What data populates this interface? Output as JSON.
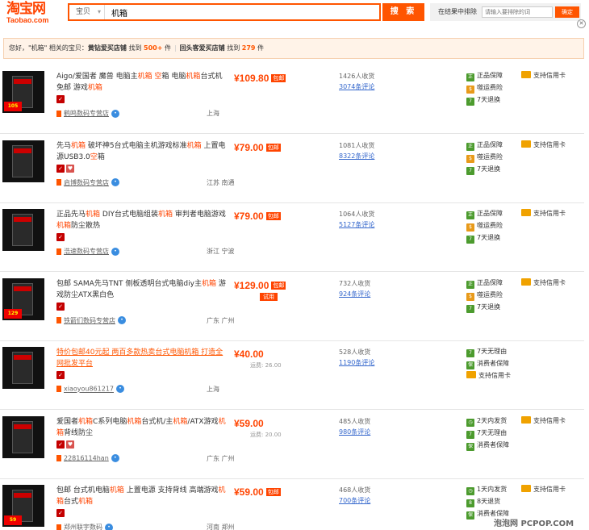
{
  "header": {
    "logo_main": "淘宝网",
    "logo_sub": "Taobao.com",
    "search_scope": "宝贝",
    "search_query": "机箱",
    "search_button": "搜 索",
    "within_label": "在结果中排除",
    "within_placeholder": "请输入要排除的词",
    "within_button": "确定"
  },
  "notice": {
    "prefix": "您好，\"机箱\" 相关的宝贝：",
    "tier1_label": "黄钻爱买店铺",
    "tier1_mid": " 找到 ",
    "tier1_count": "500+",
    "tier1_unit": " 件",
    "tier2_label": "回头客爱买店铺",
    "tier2_mid": " 找到 ",
    "tier2_count": "279",
    "tier2_unit": " 件"
  },
  "products": [
    {
      "title_parts": [
        "Aigo/爱国者 魔兽 电脑主",
        "机箱",
        " ",
        "空",
        "箱 电脑",
        "机箱",
        "台式机免邮 游戏",
        "机箱"
      ],
      "price": "¥109.80",
      "tag": "包邮",
      "trial": "",
      "freight": "",
      "sales": "1426人收货",
      "reviews": "3074条评论",
      "shop": "鹤鸣数码专营店",
      "location": "上海",
      "services": [
        "正品保障",
        "支持信用卡",
        "噬运费险",
        "7天退换"
      ],
      "thumb_badge": "105"
    },
    {
      "title_parts": [
        "先马",
        "机箱",
        " 破坏神5台式电脑主机游戏标准",
        "机箱",
        " 上置电源USB3.0",
        "空",
        "箱"
      ],
      "price": "¥79.00",
      "tag": "包邮",
      "trial": "",
      "freight": "",
      "sales": "1081人收货",
      "reviews": "8322条评论",
      "shop": "启博数码专营店",
      "location": "江苏 南通",
      "services": [
        "正品保障",
        "支持信用卡",
        "噬运费险",
        "7天退换"
      ],
      "thumb_badge": ""
    },
    {
      "title_parts": [
        "正品先马",
        "机箱",
        " DIY台式电脑组装",
        "机箱",
        " 审判者电脑游戏",
        "机箱",
        "防尘散热"
      ],
      "price": "¥79.00",
      "tag": "包邮",
      "trial": "",
      "freight": "",
      "sales": "1064人收货",
      "reviews": "5127条评论",
      "shop": "浩速数码专营店",
      "location": "浙江 宁波",
      "services": [
        "正品保障",
        "支持信用卡",
        "噬运费险",
        "7天退换"
      ],
      "thumb_badge": ""
    },
    {
      "title_parts": [
        "包邮 SAMA先马TNT 侧板透明台式电脑diy主",
        "机箱",
        " 游戏防尘ATX黑白色"
      ],
      "price": "¥129.00",
      "tag": "包邮",
      "trial": "试用",
      "freight": "",
      "sales": "732人收货",
      "reviews": "924条评论",
      "shop": "铁箭们数码专营店",
      "location": "广东 广州",
      "services": [
        "正品保障",
        "支持信用卡",
        "噬运费险",
        "7天退换"
      ],
      "thumb_badge": "129"
    },
    {
      "title_parts": [
        "特价包邮40元起 两百多款热卖台式电脑机箱 打造全网批发平台"
      ],
      "price": "¥40.00",
      "tag": "",
      "trial": "",
      "freight": "运费: 26.00",
      "sales": "528人收货",
      "reviews": "1190条评论",
      "shop": "xiaoyou861217",
      "location": "上海",
      "services": [
        "7天无理由",
        "消费者保障",
        "支持信用卡"
      ],
      "thumb_badge": ""
    },
    {
      "title_parts": [
        "爱国者",
        "机箱",
        "C系列电脑",
        "机箱",
        "台式机/主",
        "机箱",
        "/ATX游戏",
        "机箱",
        "背线防尘"
      ],
      "price": "¥59.00",
      "tag": "",
      "trial": "",
      "freight": "运费: 20.00",
      "sales": "485人收货",
      "reviews": "980条评论",
      "shop": "22816114han",
      "location": "广东 广州",
      "services": [
        "2天内发货",
        "支持信用卡",
        "7天无理由",
        "消费者保障"
      ],
      "thumb_badge": ""
    },
    {
      "title_parts": [
        "包邮 台式机电脑",
        "机箱",
        " 上置电源 支持背线 高端游戏",
        "机箱",
        "台式",
        "机箱"
      ],
      "price": "¥59.00",
      "tag": "包邮",
      "trial": "",
      "freight": "",
      "sales": "468人收货",
      "reviews": "700条评论",
      "shop": "郑州联宇数码",
      "location": "河南 郑州",
      "services": [
        "1天内发货",
        "支持信用卡",
        "8天退货",
        "消费者保障"
      ],
      "thumb_badge": "59"
    }
  ],
  "watermark": "泡泡网 PCPOP.COM",
  "colors": {
    "accent": "#ff5500",
    "price": "#ff4400",
    "service_green": "#4c9b2e"
  }
}
